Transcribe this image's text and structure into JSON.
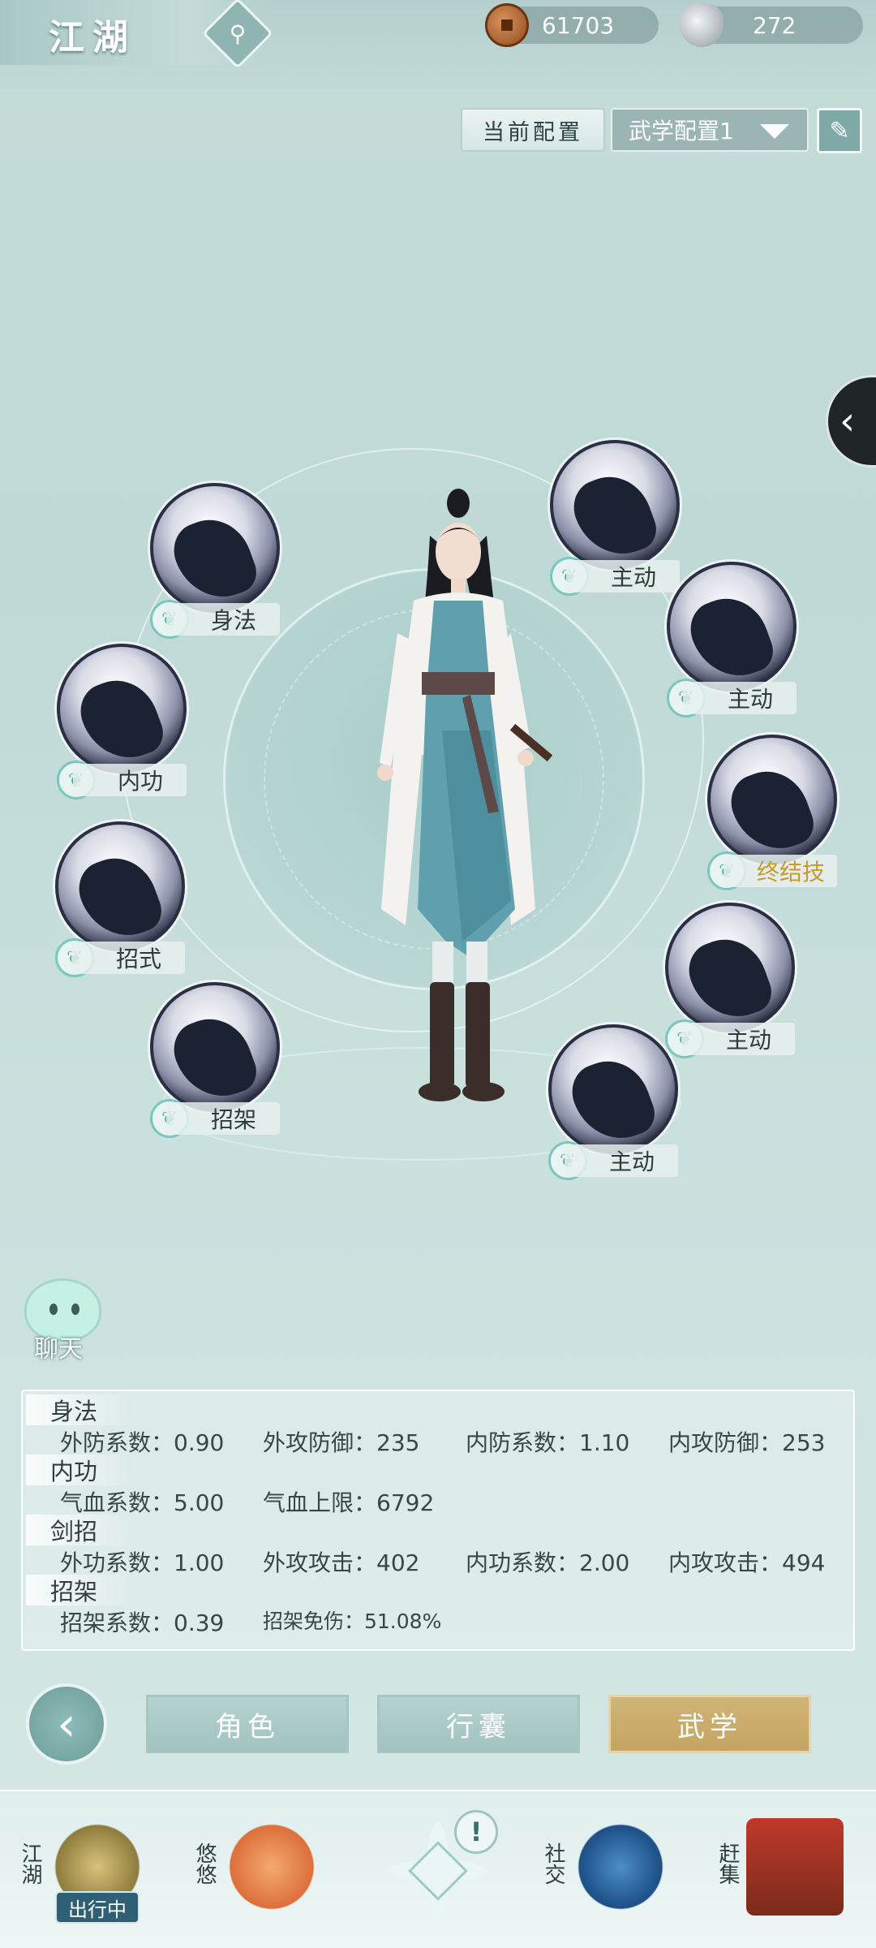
{
  "header": {
    "title": "江湖",
    "copper": "61703",
    "silver": "272"
  },
  "config": {
    "label": "当前配置",
    "selected": "武学配置1"
  },
  "skills": {
    "left": [
      {
        "label": "身法"
      },
      {
        "label": "内功"
      },
      {
        "label": "招式"
      },
      {
        "label": "招架"
      }
    ],
    "right": [
      {
        "label": "主动"
      },
      {
        "label": "主动"
      },
      {
        "label": "终结技",
        "highlight": "#c69a2d"
      },
      {
        "label": "主动"
      },
      {
        "label": "主动"
      }
    ]
  },
  "chat": {
    "label": "聊天"
  },
  "stats": {
    "shenfa": {
      "title": "身法",
      "items": [
        "外防系数：0.90",
        "外攻防御：235",
        "内防系数：1.10",
        "内攻防御：253"
      ]
    },
    "neigong": {
      "title": "内功",
      "items": [
        "气血系数：5.00",
        "气血上限：6792"
      ]
    },
    "jianzhao": {
      "title": "剑招",
      "items": [
        "外功系数：1.00",
        "外攻攻击：402",
        "内功系数：2.00",
        "内攻攻击：494"
      ]
    },
    "zhaojia": {
      "title": "招架",
      "items": [
        "招架系数：0.39",
        "招架免伤：51.08%"
      ]
    }
  },
  "tabs": [
    "角色",
    "行囊",
    "武学"
  ],
  "footer": {
    "jianghu": "江湖",
    "going": "出行中",
    "youyou": "悠悠",
    "shejiao": "社交",
    "ganji": "赶集"
  },
  "colors": {
    "accent_gold": "#c4a461",
    "accent_teal": "#8fbdb9"
  }
}
